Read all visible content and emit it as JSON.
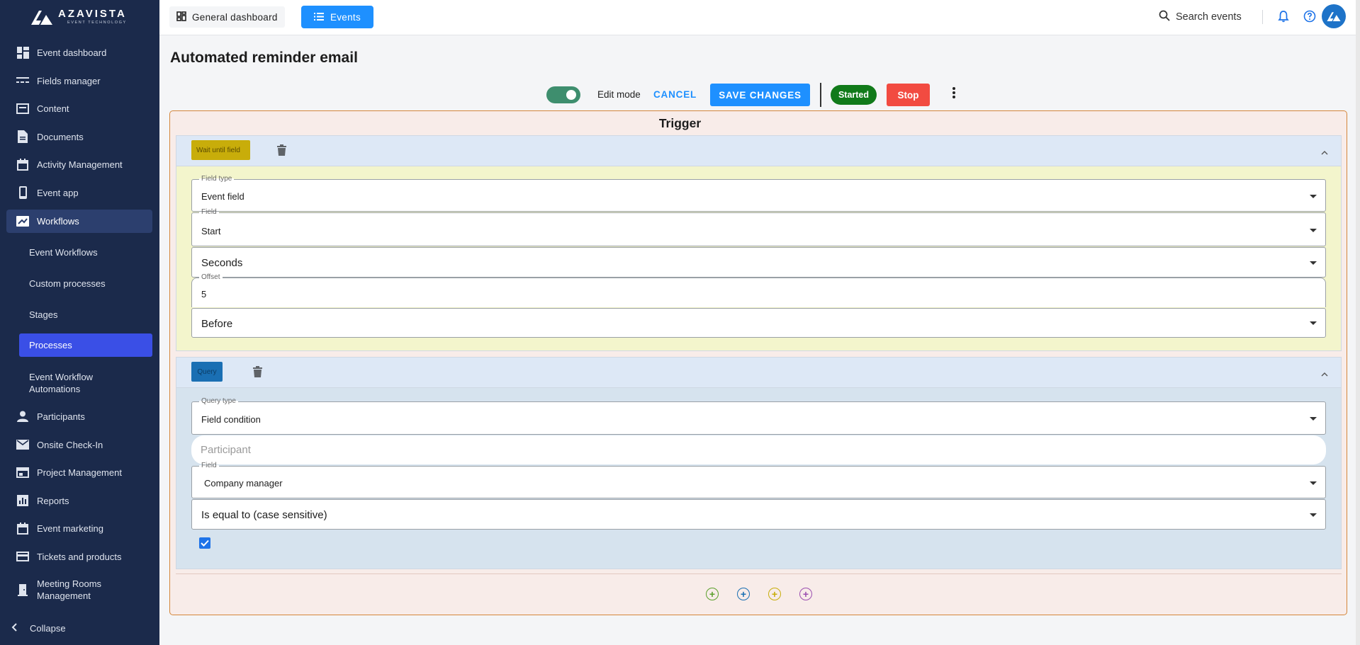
{
  "brand": {
    "name": "AZAVISTA",
    "tagline": "EVENT TECHNOLOGY"
  },
  "sidebar": {
    "items": [
      {
        "label": "Event dashboard",
        "icon": "dashboard-icon"
      },
      {
        "label": "Fields manager",
        "icon": "fields-icon"
      },
      {
        "label": "Content",
        "icon": "content-icon"
      },
      {
        "label": "Documents",
        "icon": "document-icon"
      },
      {
        "label": "Activity Management",
        "icon": "calendar-icon"
      },
      {
        "label": "Event app",
        "icon": "phone-icon"
      },
      {
        "label": "Workflows",
        "icon": "workflow-icon"
      },
      {
        "label": "Participants",
        "icon": "person-icon"
      },
      {
        "label": "Onsite Check-In",
        "icon": "mail-icon"
      },
      {
        "label": "Project Management",
        "icon": "board-icon"
      },
      {
        "label": "Reports",
        "icon": "chart-icon"
      },
      {
        "label": "Event marketing",
        "icon": "calendar-icon"
      },
      {
        "label": "Tickets and products",
        "icon": "card-icon"
      },
      {
        "label": "Meeting Rooms Management",
        "icon": "door-icon"
      }
    ],
    "sub_items": [
      "Event Workflows",
      "Custom processes",
      "Stages",
      "Processes",
      "Event Workflow Automations"
    ],
    "collapse_label": "Collapse"
  },
  "topbar": {
    "tab_general": "General dashboard",
    "tab_events": "Events",
    "search_placeholder": "Search events"
  },
  "page": {
    "title": "Automated reminder email"
  },
  "toolbar": {
    "edit_mode_label": "Edit mode",
    "edit_mode_on": true,
    "cancel": "CANCEL",
    "save": "SAVE CHANGES",
    "status": "Started",
    "stop": "Stop"
  },
  "trigger": {
    "title": "Trigger",
    "wait_block": {
      "chip": "Wait until field",
      "fields": [
        {
          "label": "Field type",
          "value": "Event field"
        },
        {
          "label": "Field",
          "value": "Start"
        },
        {
          "label": "",
          "value": "Seconds"
        },
        {
          "label": "Offset",
          "value": "5"
        },
        {
          "label": "",
          "value": "Before"
        }
      ]
    },
    "query_block": {
      "chip": "Query",
      "fields": [
        {
          "label": "Query type",
          "value": "Field condition"
        },
        {
          "label": "",
          "value": "Participant"
        },
        {
          "label": "Field",
          "value": "Company manager"
        },
        {
          "label": "",
          "value": "Is equal to (case sensitive)"
        }
      ],
      "checkbox_checked": true
    },
    "add_buttons": [
      {
        "name": "add-green",
        "color": "#5aa02c"
      },
      {
        "name": "add-blue",
        "color": "#1a6fb3"
      },
      {
        "name": "add-yellow",
        "color": "#c8ad0a"
      },
      {
        "name": "add-purple",
        "color": "#9b4fb0"
      }
    ]
  },
  "colors": {
    "sidebar_bg": "#1b2a4b",
    "accent": "#1e90ff",
    "started": "#117a1a",
    "stop": "#f24b41",
    "selected_sub": "#3a4fe6"
  }
}
